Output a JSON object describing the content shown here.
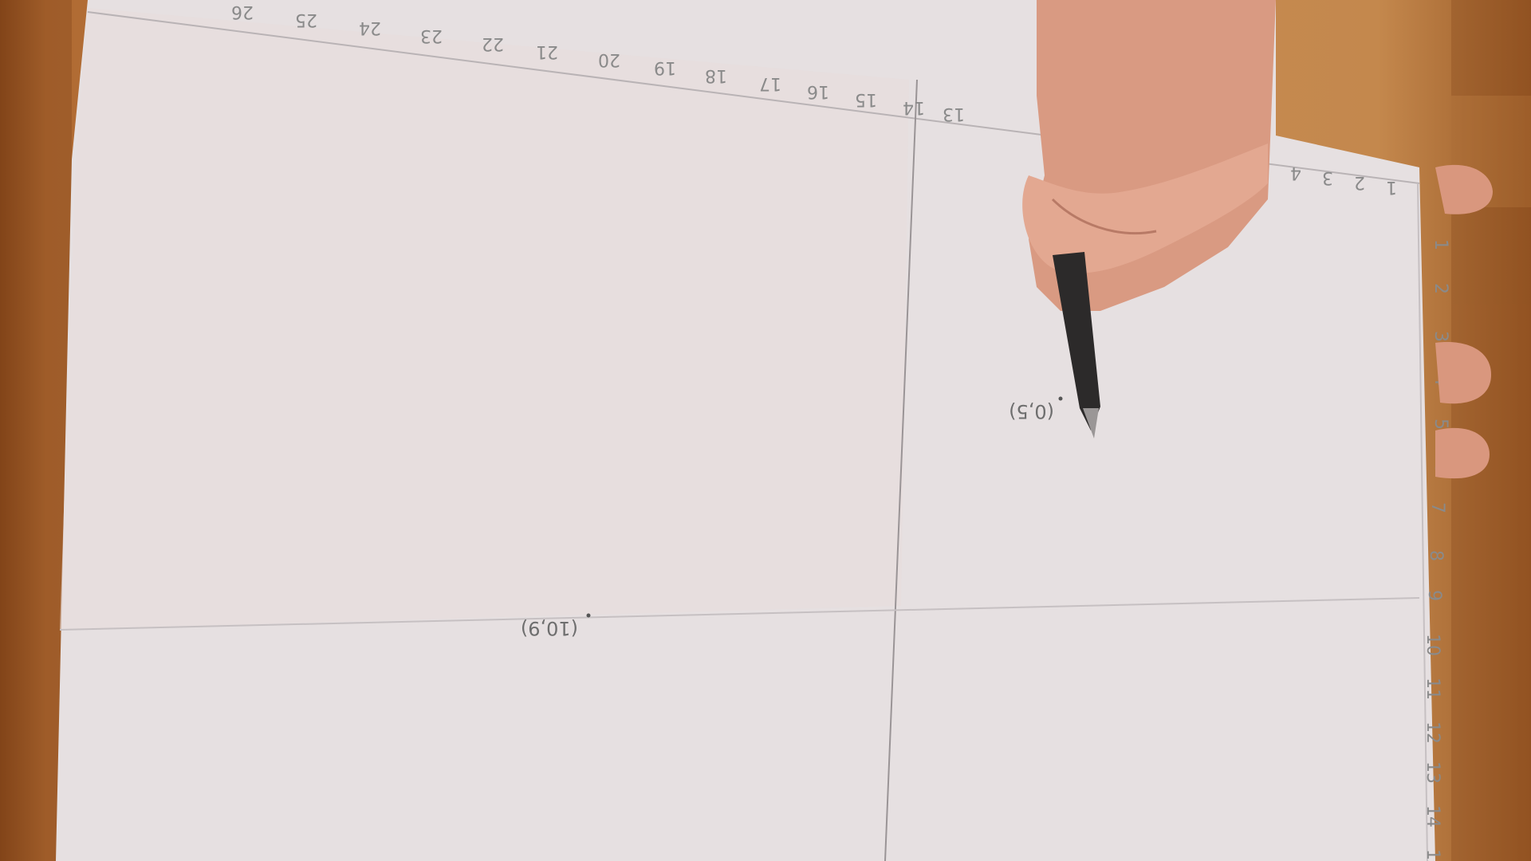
{
  "scene": {
    "description_items": [
      "wooden-table",
      "paper-sheet",
      "hand-with-pen"
    ]
  },
  "top_axis_numbers": [
    "26",
    "25",
    "24",
    "23",
    "22",
    "21",
    "20",
    "19",
    "18",
    "17",
    "16",
    "15",
    "14",
    "13"
  ],
  "top_right_numbers": [
    "4",
    "3",
    "2",
    "1"
  ],
  "right_axis_numbers": [
    "1",
    "2",
    "3",
    "4",
    "5",
    "6",
    "7",
    "8",
    "9",
    "10",
    "11",
    "12",
    "13",
    "14",
    "15"
  ],
  "points": [
    {
      "label": "(10,9)"
    },
    {
      "label": "(0,5)"
    }
  ]
}
